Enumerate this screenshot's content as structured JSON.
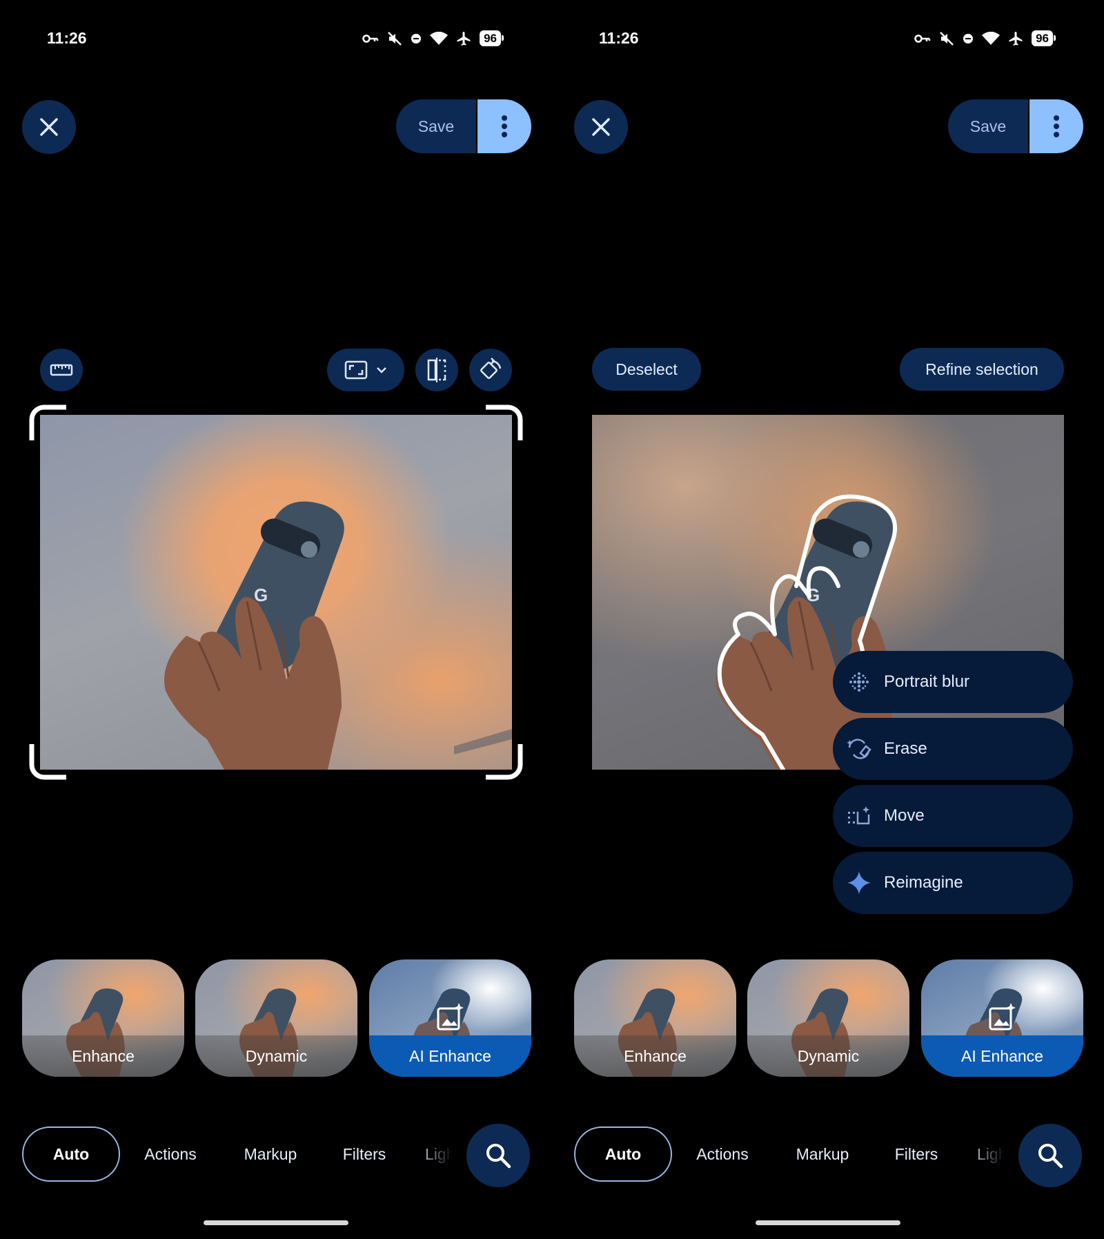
{
  "status_bar": {
    "time": "11:26",
    "battery": "96"
  },
  "header": {
    "save_label": "Save"
  },
  "selection": {
    "deselect_label": "Deselect",
    "refine_label": "Refine selection"
  },
  "photo": {
    "logo_letter": "G"
  },
  "actions_menu": {
    "items": [
      {
        "label": "Portrait blur",
        "icon": "portrait-blur-icon"
      },
      {
        "label": "Erase",
        "icon": "erase-icon"
      },
      {
        "label": "Move",
        "icon": "move-icon"
      },
      {
        "label": "Reimagine",
        "icon": "reimagine-sparkle-icon"
      }
    ]
  },
  "suggestions": [
    {
      "label": "Enhance"
    },
    {
      "label": "Dynamic"
    },
    {
      "label": "AI Enhance",
      "selected": true
    }
  ],
  "tabs": [
    "Auto",
    "Actions",
    "Markup",
    "Filters",
    "Light"
  ],
  "active_tab": "Auto",
  "colors": {
    "accent": "#8cc0ff",
    "button_bg": "#0d2a55",
    "ai_tile": "#0b5bb5",
    "menu_bg": "#061a3a"
  }
}
